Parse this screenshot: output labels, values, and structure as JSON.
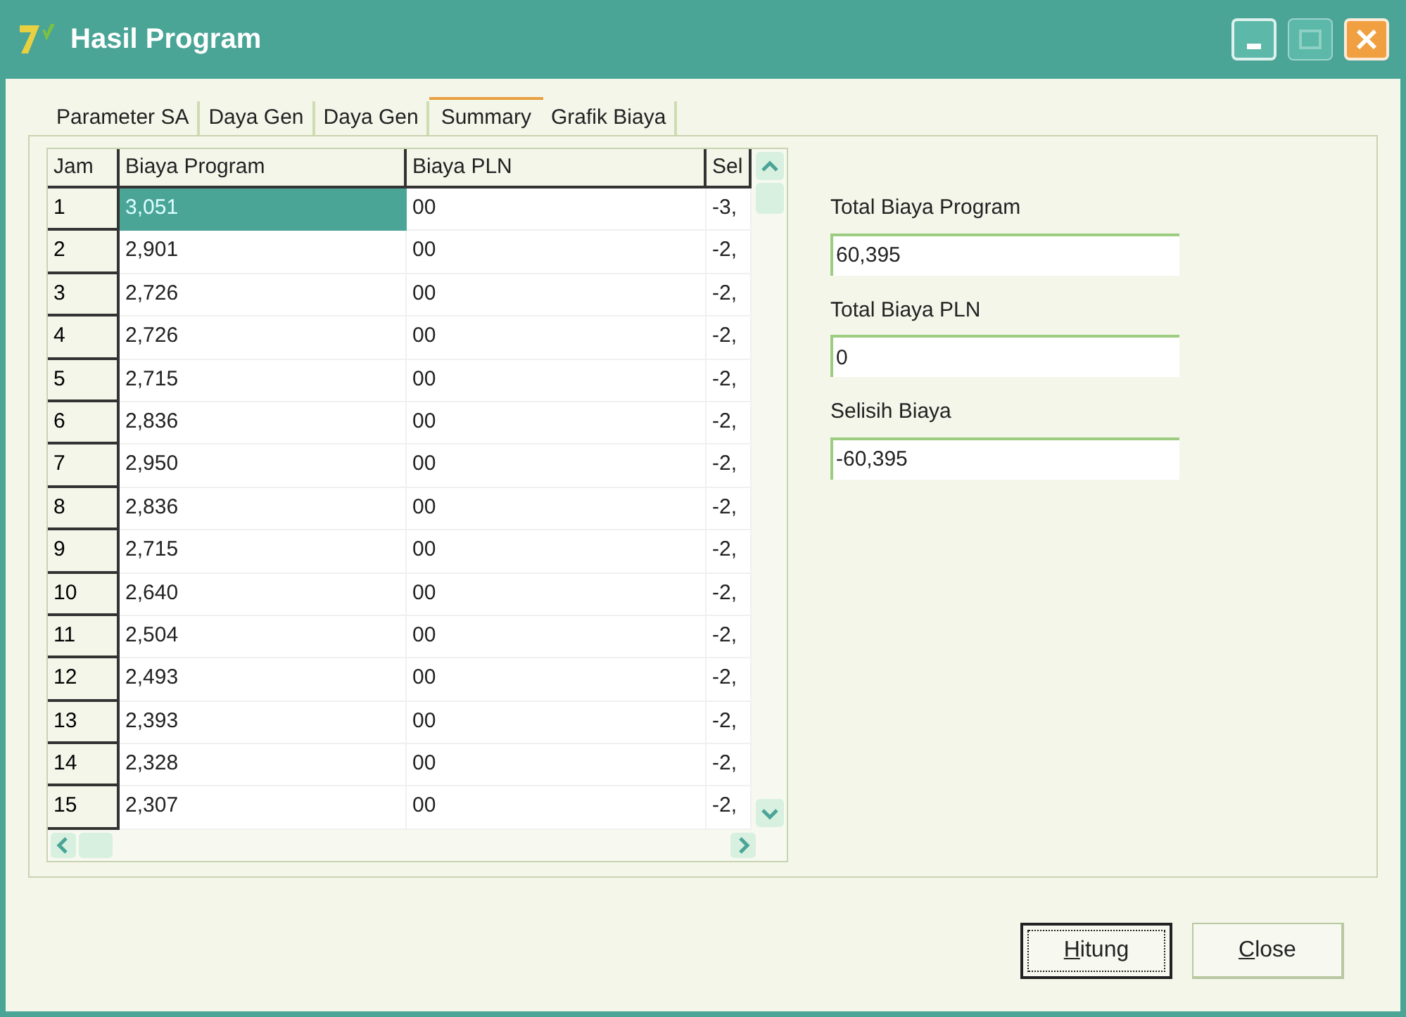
{
  "window": {
    "title": "Hasil Program"
  },
  "tabs": [
    {
      "label": "Parameter SA",
      "selected": false
    },
    {
      "label": "Daya Gen",
      "selected": false
    },
    {
      "label": "Daya Gen",
      "selected": false
    },
    {
      "label": "Summary",
      "selected": true
    },
    {
      "label": "Grafik Biaya",
      "selected": false
    }
  ],
  "table": {
    "columns": [
      "Jam",
      "Biaya Program",
      "Biaya PLN",
      "Sel"
    ],
    "rows": [
      {
        "cells": [
          "1",
          "3,051",
          "00",
          "-3,"
        ],
        "selected": true
      },
      {
        "cells": [
          "2",
          "2,901",
          "00",
          "-2,"
        ],
        "selected": false
      },
      {
        "cells": [
          "3",
          "2,726",
          "00",
          "-2,"
        ],
        "selected": false
      },
      {
        "cells": [
          "4",
          "2,726",
          "00",
          "-2,"
        ],
        "selected": false
      },
      {
        "cells": [
          "5",
          "2,715",
          "00",
          "-2,"
        ],
        "selected": false
      },
      {
        "cells": [
          "6",
          "2,836",
          "00",
          "-2,"
        ],
        "selected": false
      },
      {
        "cells": [
          "7",
          "2,950",
          "00",
          "-2,"
        ],
        "selected": false
      },
      {
        "cells": [
          "8",
          "2,836",
          "00",
          "-2,"
        ],
        "selected": false
      },
      {
        "cells": [
          "9",
          "2,715",
          "00",
          "-2,"
        ],
        "selected": false
      },
      {
        "cells": [
          "10",
          "2,640",
          "00",
          "-2,"
        ],
        "selected": false
      },
      {
        "cells": [
          "11",
          "2,504",
          "00",
          "-2,"
        ],
        "selected": false
      },
      {
        "cells": [
          "12",
          "2,493",
          "00",
          "-2,"
        ],
        "selected": false
      },
      {
        "cells": [
          "13",
          "2,393",
          "00",
          "-2,"
        ],
        "selected": false
      },
      {
        "cells": [
          "14",
          "2,328",
          "00",
          "-2,"
        ],
        "selected": false
      },
      {
        "cells": [
          "15",
          "2,307",
          "00",
          "-2,"
        ],
        "selected": false
      }
    ]
  },
  "summary": [
    {
      "label": "Total Biaya Program",
      "value": "60,395"
    },
    {
      "label": "Total Biaya PLN",
      "value": "0"
    },
    {
      "label": "Selisih Biaya",
      "value": "-60,395"
    }
  ],
  "buttons": [
    {
      "label": "Hitung",
      "focused": true
    },
    {
      "label": "Close",
      "focused": false
    }
  ]
}
